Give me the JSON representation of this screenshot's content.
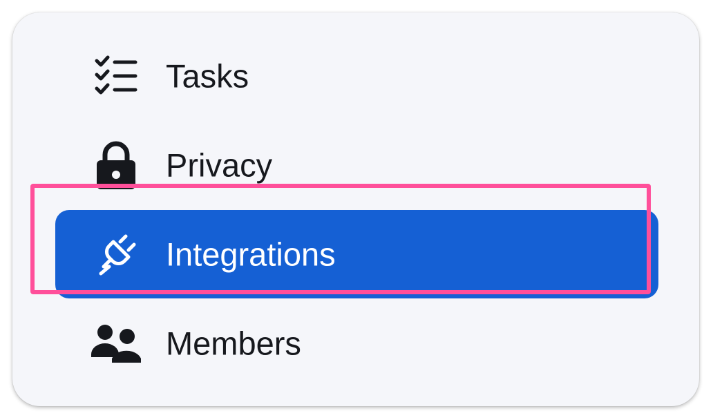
{
  "menu": {
    "items": [
      {
        "label": "Tasks",
        "icon": "tasks-checklist-icon",
        "active": false
      },
      {
        "label": "Privacy",
        "icon": "lock-icon",
        "active": false
      },
      {
        "label": "Integrations",
        "icon": "plug-icon",
        "active": true
      },
      {
        "label": "Members",
        "icon": "users-icon",
        "active": false
      }
    ]
  },
  "colors": {
    "panel_background": "#f5f6fa",
    "active_background": "#1560d4",
    "focus_ring": "#ff4f9a",
    "text": "#16181d",
    "active_text": "#ffffff"
  }
}
